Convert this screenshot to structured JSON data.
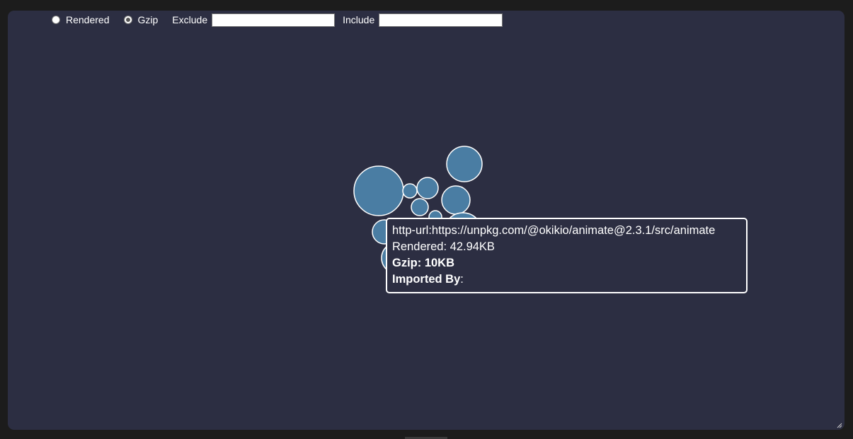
{
  "toolbar": {
    "size_mode_options": [
      {
        "label": "Rendered",
        "selected": false
      },
      {
        "label": "Gzip",
        "selected": true
      }
    ],
    "exclude_label": "Exclude",
    "exclude_value": "",
    "include_label": "Include",
    "include_value": ""
  },
  "tooltip": {
    "module": "http-url:https://unpkg.com/@okikio/animate@2.3.1/src/animate",
    "rendered": "Rendered: 42.94KB",
    "gzip": "Gzip: 10KB",
    "imported_by_label": "Imported By",
    "imported_by_suffix": ":"
  },
  "colors": {
    "background": "#1c1c1c",
    "panel": "#2c2e42",
    "bubble_fill": "#4a7da3",
    "bubble_stroke": "#ffffff"
  }
}
